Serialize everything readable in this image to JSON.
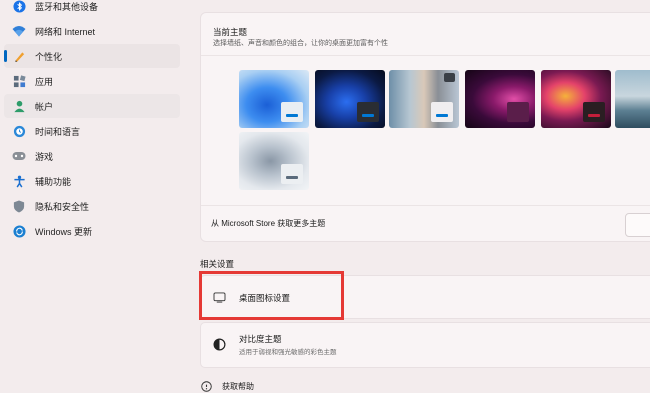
{
  "sidebar": {
    "items": [
      {
        "label": "蓝牙和其他设备",
        "icon": "bluetooth-icon"
      },
      {
        "label": "网络和 Internet",
        "icon": "wifi-icon"
      },
      {
        "label": "个性化",
        "icon": "pencil-icon",
        "active": true
      },
      {
        "label": "应用",
        "icon": "apps-icon"
      },
      {
        "label": "帐户",
        "icon": "person-icon"
      },
      {
        "label": "时间和语言",
        "icon": "globe-clock-icon"
      },
      {
        "label": "游戏",
        "icon": "gamepad-icon"
      },
      {
        "label": "辅助功能",
        "icon": "accessibility-icon"
      },
      {
        "label": "隐私和安全性",
        "icon": "shield-icon"
      },
      {
        "label": "Windows 更新",
        "icon": "update-icon"
      }
    ]
  },
  "themes": {
    "title": "当前主题",
    "subtitle": "选择墙纸、声音和颜色的组合，让你的桌面更加富有个性",
    "store_text": "从 Microsoft Store 获取更多主题",
    "items": [
      {
        "name": "windows-light",
        "accent": "#0078d4"
      },
      {
        "name": "windows-dark",
        "accent": "#0078d4"
      },
      {
        "name": "spotlight",
        "accent": "#0078d4"
      },
      {
        "name": "glow",
        "accent": "#b1166b"
      },
      {
        "name": "captured-motion",
        "accent": "#c41e3a"
      },
      {
        "name": "flow",
        "accent": "#0078d4"
      },
      {
        "name": "sunrise",
        "accent": "#0078d4"
      }
    ]
  },
  "related": {
    "label": "相关设置",
    "desktop_icons": {
      "title": "桌面图标设置"
    },
    "contrast": {
      "title": "对比度主题",
      "subtitle": "适用于弱视和强光敏感的彩色主题"
    }
  },
  "help": {
    "label": "获取帮助"
  },
  "colors": {
    "highlight": "#e53935",
    "accent": "#0067c0"
  }
}
